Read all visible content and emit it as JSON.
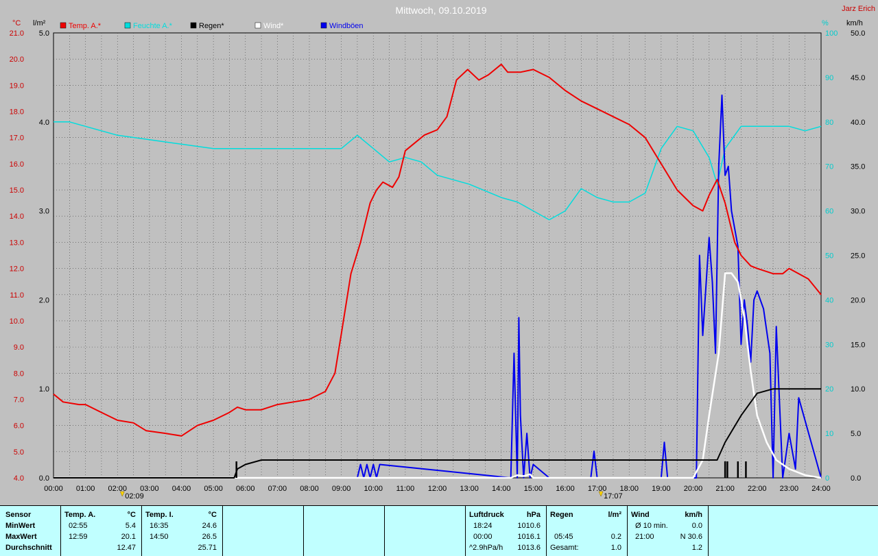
{
  "title": "Mittwoch, 09.10.2019",
  "author": "Jarz Erich",
  "colors": {
    "background": "#c0c0c0",
    "temp": "#ee0000",
    "humidity": "#00dddd",
    "rain": "#000000",
    "wind": "#ffffff",
    "gust": "#0000ee",
    "panel": "#c0ffff"
  },
  "axes": {
    "temp_unit": "°C",
    "rain_unit": "l/m²",
    "hum_unit": "%",
    "wind_unit": "km/h",
    "temp_ticks": [
      "21.0",
      "20.0",
      "19.0",
      "18.0",
      "17.0",
      "16.0",
      "15.0",
      "14.0",
      "13.0",
      "12.0",
      "11.0",
      "10.0",
      "9.0",
      "8.0",
      "7.0",
      "6.0",
      "5.0",
      "4.0"
    ],
    "rain_ticks": [
      "5.0",
      "4.0",
      "3.0",
      "2.0",
      "1.0",
      "0.0"
    ],
    "hum_ticks": [
      "100",
      "90",
      "80",
      "70",
      "60",
      "50",
      "40",
      "30",
      "20",
      "10",
      "0"
    ],
    "wind_ticks": [
      "50.0",
      "45.0",
      "40.0",
      "35.0",
      "30.0",
      "25.0",
      "20.0",
      "15.0",
      "10.0",
      "5.0",
      "0.0"
    ],
    "time_ticks": [
      "00:00",
      "01:00",
      "02:00",
      "03:00",
      "04:00",
      "05:00",
      "06:00",
      "07:00",
      "08:00",
      "09:00",
      "10:00",
      "11:00",
      "12:00",
      "13:00",
      "14:00",
      "15:00",
      "16:00",
      "17:00",
      "18:00",
      "19:00",
      "20:00",
      "21:00",
      "22:00",
      "23:00",
      "24:00"
    ],
    "sunrise": "02:09",
    "sunset": "17:07"
  },
  "legend": [
    {
      "label": "Temp. A.*",
      "color": "#ee0000"
    },
    {
      "label": "Feuchte A.*",
      "color": "#00dddd"
    },
    {
      "label": "Regen*",
      "color": "#000000"
    },
    {
      "label": "Wind*",
      "color": "#ffffff"
    },
    {
      "label": "Windböen",
      "color": "#0000ee"
    }
  ],
  "chart_data": {
    "type": "line",
    "x_range": [
      0,
      24
    ],
    "ylim_temp": [
      4,
      21
    ],
    "ylim_rain": [
      0,
      5
    ],
    "ylim_hum": [
      0,
      100
    ],
    "ylim_wind": [
      0,
      50
    ],
    "grid": true,
    "legend_placement": "top-left",
    "series": [
      {
        "name": "Temp. A.*",
        "axis": "temp",
        "x": [
          0,
          0.3,
          0.8,
          1.0,
          1.5,
          2.0,
          2.5,
          2.9,
          3.5,
          4.0,
          4.5,
          5.0,
          5.5,
          5.75,
          6.0,
          6.5,
          7.0,
          7.5,
          8.0,
          8.5,
          8.8,
          9.0,
          9.3,
          9.6,
          9.9,
          10.1,
          10.3,
          10.6,
          10.8,
          11.0,
          11.3,
          11.6,
          12.0,
          12.3,
          12.6,
          12.95,
          13.3,
          13.6,
          14.0,
          14.2,
          14.6,
          15.0,
          15.5,
          16.0,
          16.5,
          17.0,
          17.5,
          18.0,
          18.5,
          19.0,
          19.5,
          20.0,
          20.3,
          20.5,
          20.75,
          21.0,
          21.3,
          21.5,
          21.8,
          22.0,
          22.5,
          22.8,
          23.0,
          23.3,
          23.6,
          24.0
        ],
        "y": [
          7.2,
          6.9,
          6.8,
          6.8,
          6.5,
          6.2,
          6.1,
          5.8,
          5.7,
          5.6,
          6.0,
          6.2,
          6.5,
          6.7,
          6.6,
          6.6,
          6.8,
          6.9,
          7.0,
          7.3,
          8.0,
          9.5,
          11.8,
          13.0,
          14.5,
          15.0,
          15.3,
          15.1,
          15.5,
          16.5,
          16.8,
          17.1,
          17.3,
          17.8,
          19.2,
          19.6,
          19.2,
          19.4,
          19.8,
          19.5,
          19.5,
          19.6,
          19.3,
          18.8,
          18.4,
          18.1,
          17.8,
          17.5,
          17.0,
          16.0,
          15.0,
          14.4,
          14.2,
          14.8,
          15.4,
          14.5,
          13.0,
          12.5,
          12.1,
          12.0,
          11.8,
          11.8,
          12.0,
          11.8,
          11.6,
          11.0
        ]
      },
      {
        "name": "Feuchte A.*",
        "axis": "hum",
        "x": [
          0,
          0.5,
          1.0,
          2.0,
          3.0,
          4.0,
          5.0,
          6.0,
          7.0,
          8.0,
          9.0,
          9.5,
          10.0,
          10.5,
          11.0,
          11.5,
          12.0,
          13.0,
          14.0,
          14.5,
          15.0,
          15.5,
          16.0,
          16.5,
          17.0,
          17.5,
          18.0,
          18.5,
          19.0,
          19.5,
          20.0,
          20.5,
          20.75,
          21.0,
          21.5,
          22.0,
          22.5,
          23.0,
          23.5,
          24.0
        ],
        "y": [
          80,
          80,
          79,
          77,
          76,
          75,
          74,
          74,
          74,
          74,
          74,
          77,
          74,
          71,
          72,
          71,
          68,
          66,
          63,
          62,
          60,
          58,
          60,
          65,
          63,
          62,
          62,
          64,
          74,
          79,
          78,
          72,
          66,
          74,
          79,
          79,
          79,
          79,
          78,
          79
        ]
      },
      {
        "name": "Regen*",
        "axis": "rain",
        "x": [
          0,
          5.65,
          5.75,
          6.0,
          6.5,
          7.0,
          20.75,
          21.0,
          21.5,
          22.0,
          22.5,
          23.0,
          24.0
        ],
        "y": [
          0,
          0,
          0.1,
          0.15,
          0.2,
          0.2,
          0.2,
          0.4,
          0.7,
          0.95,
          1.0,
          1.0,
          1.0
        ]
      },
      {
        "name": "Wind*",
        "axis": "wind",
        "x": [
          0,
          14.3,
          14.5,
          14.7,
          14.9,
          15.0,
          20.0,
          20.3,
          20.5,
          20.8,
          21.0,
          21.2,
          21.4,
          21.6,
          21.8,
          22.0,
          22.3,
          22.6,
          23.0,
          23.5,
          24.0
        ],
        "y": [
          0,
          0,
          0.3,
          0.2,
          0.4,
          0,
          0,
          2,
          7,
          14,
          23,
          23,
          22,
          18,
          12,
          7,
          4,
          2,
          1,
          0.3,
          0
        ]
      },
      {
        "name": "Windböen",
        "axis": "wind",
        "x": [
          0,
          9.5,
          9.6,
          9.7,
          9.8,
          9.9,
          10.0,
          10.1,
          10.2,
          14.3,
          14.4,
          14.5,
          14.55,
          14.6,
          14.7,
          14.8,
          14.9,
          15.0,
          15.5,
          16.8,
          16.9,
          17.0,
          19.0,
          19.1,
          19.2,
          20.1,
          20.2,
          20.3,
          20.5,
          20.6,
          20.7,
          20.8,
          20.9,
          21.0,
          21.1,
          21.2,
          21.3,
          21.4,
          21.5,
          21.6,
          21.7,
          21.8,
          21.9,
          22.0,
          22.2,
          22.4,
          22.5,
          22.6,
          22.8,
          23.0,
          23.2,
          23.3,
          24.0
        ],
        "y": [
          0,
          0,
          1.5,
          0,
          1.5,
          0,
          1.5,
          0,
          1.5,
          0,
          14,
          0,
          18,
          7,
          0,
          5,
          0,
          1.5,
          0,
          0,
          3,
          0,
          0,
          4,
          0,
          0,
          25,
          16,
          27,
          22,
          14,
          35,
          43,
          34,
          35,
          30,
          28,
          26,
          15,
          20,
          17,
          13,
          20,
          21,
          19,
          14,
          0,
          17,
          0,
          5,
          1,
          9,
          0
        ]
      }
    ]
  },
  "panel": {
    "sensor": {
      "header": "Sensor",
      "rows": [
        "MinWert",
        "MaxWert",
        "Durchschnitt"
      ]
    },
    "temp_a": {
      "header": "Temp. A.",
      "unit": "°C",
      "min_time": "02:55",
      "min_val": "5.4",
      "max_time": "12:59",
      "max_val": "20.1",
      "avg": "12.47"
    },
    "temp_i": {
      "header": "Temp. I.",
      "unit": "°C",
      "min_time": "16:35",
      "min_val": "24.6",
      "max_time": "14:50",
      "max_val": "26.5",
      "avg": "25.71"
    },
    "luftdruck": {
      "header": "Luftdruck",
      "unit": "hPa",
      "min_time": "18:24",
      "min_val": "1010.6",
      "max_time": "00:00",
      "max_val": "1016.1",
      "avg_label": "^2.9hPa/h",
      "avg": "1013.6"
    },
    "regen": {
      "header": "Regen",
      "unit": "l/m²",
      "max_time": "05:45",
      "max_val": "0.2",
      "total_label": "Gesamt:",
      "total": "1.0"
    },
    "wind": {
      "header": "Wind",
      "unit": "km/h",
      "min_label": "Ø 10 min.",
      "min_val": "0.0",
      "max_time": "21:00",
      "max_val": "N 30.6",
      "avg": "1.2"
    }
  }
}
